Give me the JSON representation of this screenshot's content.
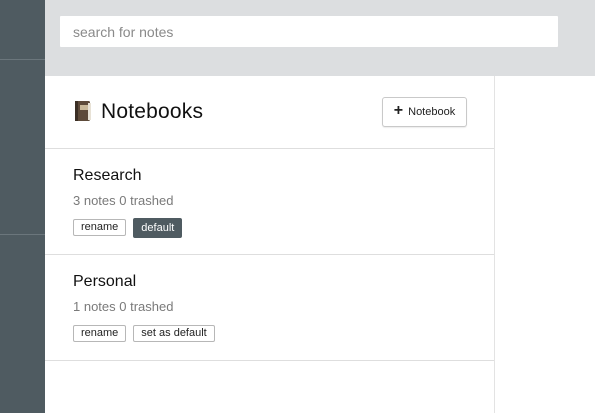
{
  "search": {
    "placeholder": "search for notes"
  },
  "header": {
    "title": "Notebooks",
    "add_button_label": "Notebook"
  },
  "notebooks": [
    {
      "name": "Research",
      "stats": "3 notes 0 trashed",
      "rename_label": "rename",
      "default_label": "default",
      "is_default": true
    },
    {
      "name": "Personal",
      "stats": "1 notes 0 trashed",
      "rename_label": "rename",
      "default_label": "set as default",
      "is_default": false
    }
  ],
  "colors": {
    "rail": "#4f5b61",
    "search_band": "#dcdee0",
    "active_tag": "#4f5b61"
  }
}
